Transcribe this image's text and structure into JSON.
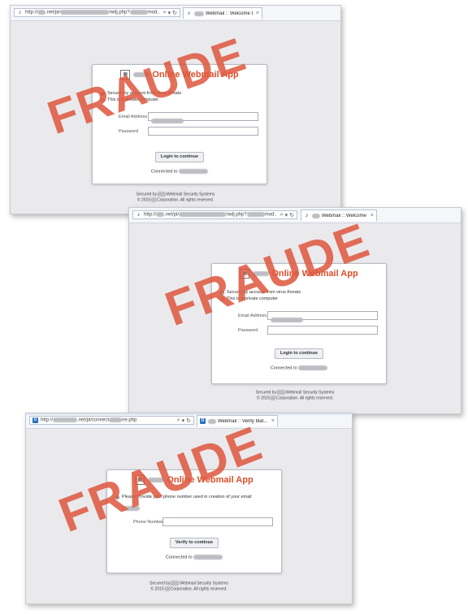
{
  "stamp_color": "#df5840",
  "accent_color": "#d9502a",
  "screenshots": [
    {
      "url_prefix": "http://",
      "url_mid": ".net/pi/",
      "url_suffix": "/wdj.php?",
      "url_tail": "mod..",
      "tab_title": "Webmail :: Welcome t...",
      "app_title": "Online Webmail App",
      "radio_secure": "Secure my account from virus threats",
      "radio_private": "This is a private computer",
      "label_email": "Email Address",
      "label_password": "Password",
      "button": "Login to continue",
      "connected": "Connected to",
      "footer_line1_a": "Secured by",
      "footer_line1_b": "Webmail Security Systems",
      "footer_line2_a": "© 2015",
      "footer_line2_b": "Corporation. All rights reserved.",
      "stamp": "FRAUDE"
    },
    {
      "url_prefix": "http://",
      "url_mid": ".net/pi/",
      "url_suffix": "/wdj.php?",
      "url_tail": "mod..",
      "tab_title": "Webmail :: Welcome t...",
      "app_title": "Online Webmail App",
      "radio_secure": "Secure my account from virus threats",
      "radio_private": "This is a private computer",
      "label_email": "Email Address",
      "label_password": "Password",
      "button": "Login to continue",
      "connected": "Connected to",
      "footer_line1_a": "Secured by",
      "footer_line1_b": "Webmail Security Systems",
      "footer_line2_a": "© 2015",
      "footer_line2_b": "Corporation. All rights reserved.",
      "stamp": "FRAUDE"
    },
    {
      "url_prefix": "http://",
      "url_mid": ".net/pi/connect",
      "url_suffix": "ne.php",
      "tab_title": "Webmail :: Verify blat...",
      "app_title": "Online Webmail App",
      "phone_prompt": "Please Provide your phone number used in creation of your email",
      "label_phone": "Phone Number",
      "button": "Verify to continue",
      "connected": "Connected to",
      "footer_line1_a": "Secured by",
      "footer_line1_b": "Webmail Security Systems",
      "footer_line2_a": "© 2015",
      "footer_line2_b": "Corporation. All rights reserved.",
      "stamp": "FRAUDE"
    }
  ]
}
